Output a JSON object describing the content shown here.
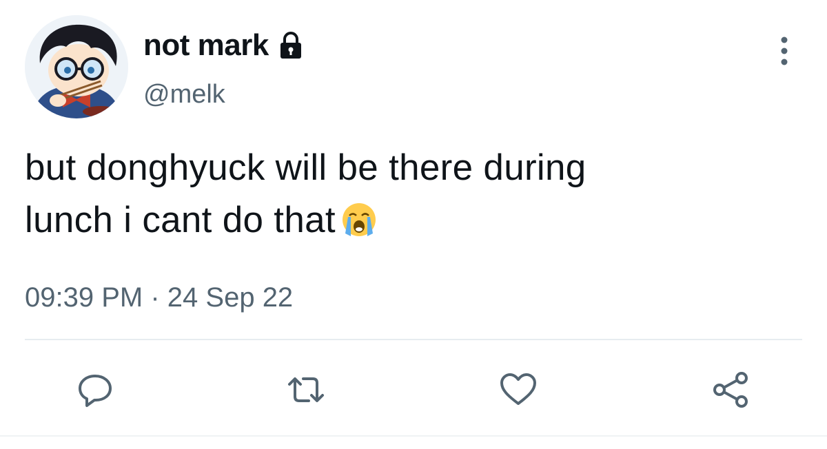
{
  "tweet": {
    "author": {
      "display_name": "not mark",
      "handle": "@melk",
      "protected_icon": "lock-icon",
      "avatar": "cartoon-avatar"
    },
    "text_lines": [
      "but donghyuck will be there during",
      "lunch i cant do that"
    ],
    "emoji": "loudly-crying-face-icon",
    "time": "09:39 PM",
    "separator": "·",
    "date": "24 Sep 22"
  },
  "actions": [
    {
      "name": "reply",
      "icon": "reply-icon"
    },
    {
      "name": "retweet",
      "icon": "retweet-icon"
    },
    {
      "name": "like",
      "icon": "heart-icon"
    },
    {
      "name": "share",
      "icon": "share-icon"
    }
  ],
  "menu_icon": "more-options-icon",
  "colors": {
    "text_primary": "#0f1419",
    "text_secondary": "#536471",
    "divider": "#e6ecf0"
  }
}
